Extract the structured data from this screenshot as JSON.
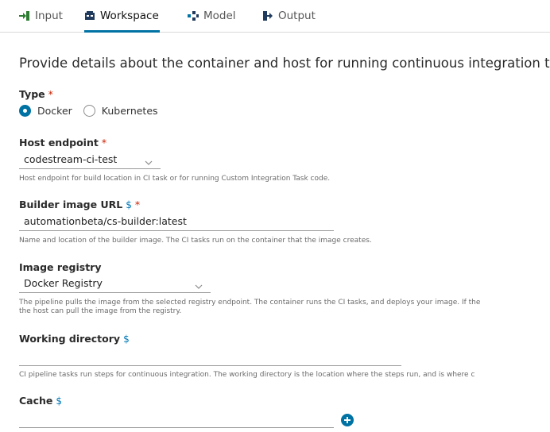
{
  "tabs": [
    {
      "label": "Input",
      "icon": "input-icon"
    },
    {
      "label": "Workspace",
      "icon": "workspace-icon",
      "active": true
    },
    {
      "label": "Model",
      "icon": "model-icon"
    },
    {
      "label": "Output",
      "icon": "output-icon"
    }
  ],
  "intro": "Provide details about the container and host for running continuous integration tasks.",
  "type": {
    "label": "Type",
    "required_mark": "*",
    "options": [
      "Docker",
      "Kubernetes"
    ],
    "selected": "Docker"
  },
  "host_endpoint": {
    "label": "Host endpoint",
    "required_mark": "*",
    "value": "codestream-ci-test",
    "help": "Host endpoint for build location in CI task or for running Custom Integration Task code."
  },
  "builder_image": {
    "label": "Builder image URL",
    "dollar": "$",
    "required_mark": "*",
    "value": "automationbeta/cs-builder:latest",
    "help": "Name and location of the builder image. The CI tasks run on the container that the image creates."
  },
  "image_registry": {
    "label": "Image registry",
    "value": "Docker Registry",
    "help_line1": "The pipeline pulls the image from the selected registry endpoint. The container runs the CI tasks, and deploys your image. If the",
    "help_line2": "the host can pull the image from the registry."
  },
  "working_directory": {
    "label": "Working directory",
    "dollar": "$",
    "value": "",
    "help": "CI pipeline tasks run steps for continuous integration. The working directory is the location where the steps run, and is where c"
  },
  "cache": {
    "label": "Cache",
    "dollar": "$",
    "value": ""
  },
  "colors": {
    "accent": "#0072a3",
    "required": "#c92100",
    "link": "#0079b8"
  }
}
